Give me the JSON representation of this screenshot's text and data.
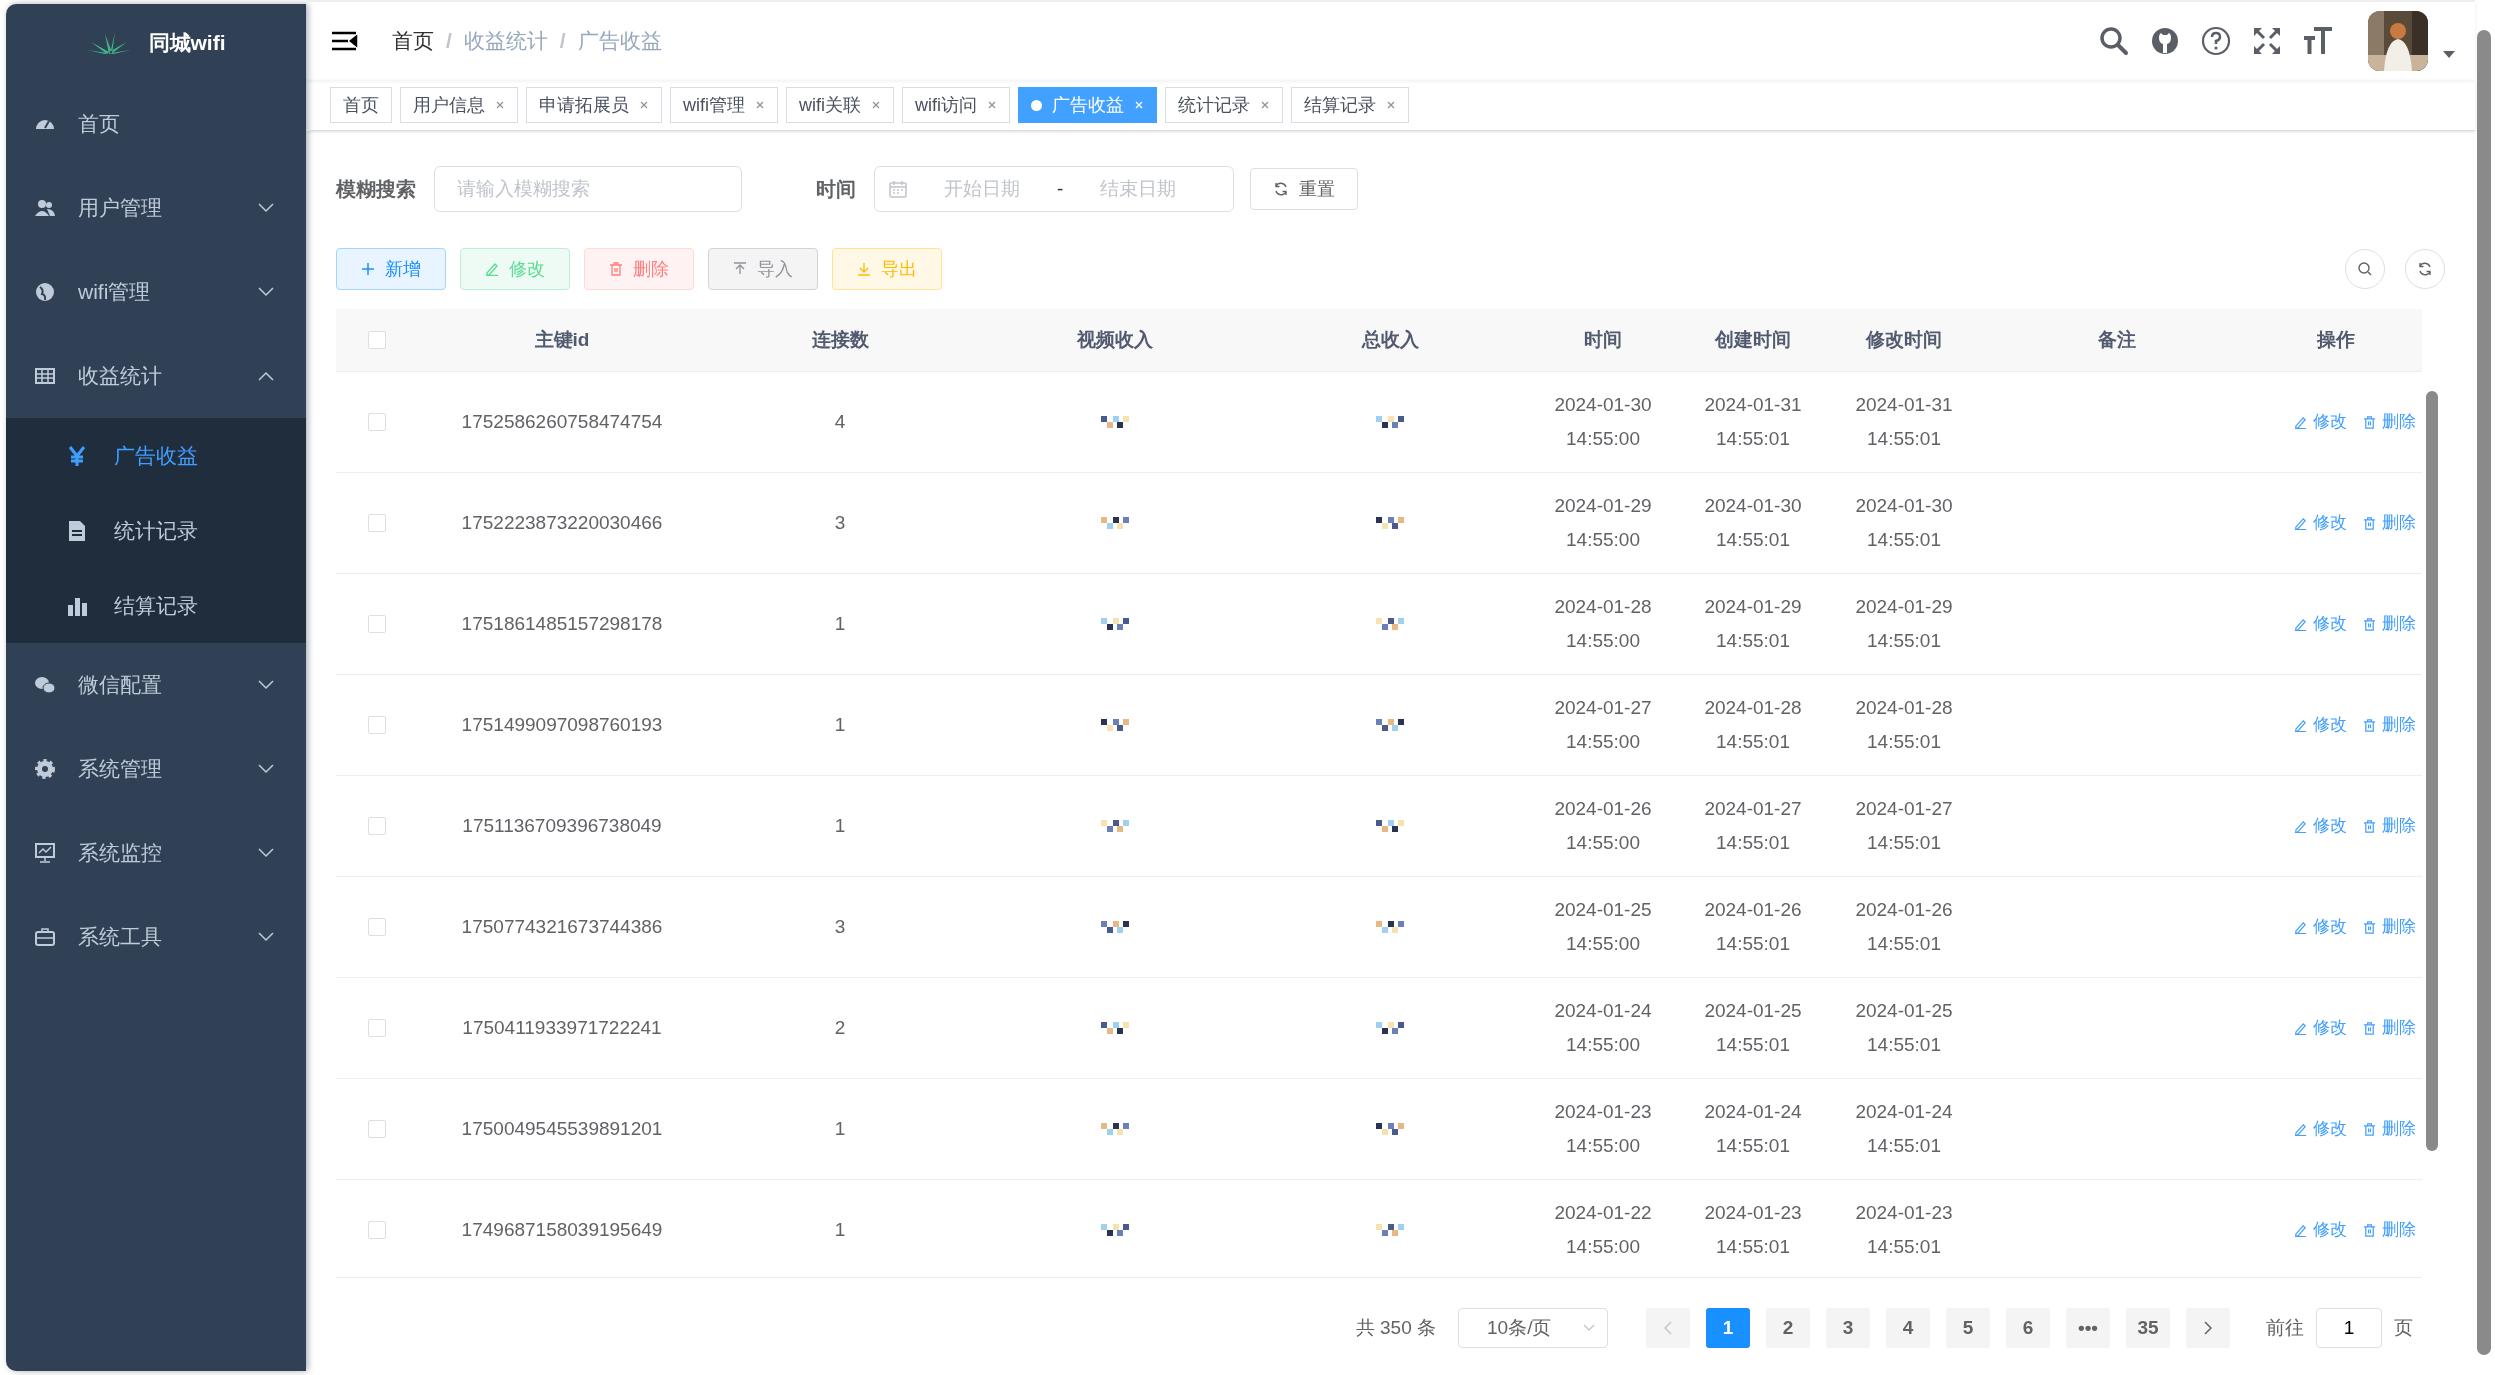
{
  "sidebar": {
    "logo": "同城wifi",
    "items": [
      {
        "label": "首页",
        "kind": "link"
      },
      {
        "label": "用户管理",
        "kind": "group",
        "expanded": false
      },
      {
        "label": "wifi管理",
        "kind": "group",
        "expanded": false
      },
      {
        "label": "收益统计",
        "kind": "group",
        "expanded": true,
        "children": [
          {
            "label": "广告收益",
            "selected": true
          },
          {
            "label": "统计记录",
            "selected": false
          },
          {
            "label": "结算记录",
            "selected": false
          }
        ]
      },
      {
        "label": "微信配置",
        "kind": "group",
        "expanded": false
      },
      {
        "label": "系统管理",
        "kind": "group",
        "expanded": false
      },
      {
        "label": "系统监控",
        "kind": "group",
        "expanded": false
      },
      {
        "label": "系统工具",
        "kind": "group",
        "expanded": false
      }
    ]
  },
  "breadcrumb": {
    "separator": "/",
    "items": [
      "首页",
      "收益统计",
      "广告收益"
    ]
  },
  "tabs": [
    {
      "label": "首页",
      "selected": false,
      "closable": false
    },
    {
      "label": "用户信息",
      "selected": false,
      "closable": true
    },
    {
      "label": "申请拓展员",
      "selected": false,
      "closable": true
    },
    {
      "label": "wifi管理",
      "selected": false,
      "closable": true
    },
    {
      "label": "wifi关联",
      "selected": false,
      "closable": true
    },
    {
      "label": "wifi访问",
      "selected": false,
      "closable": true
    },
    {
      "label": "广告收益",
      "selected": true,
      "closable": true
    },
    {
      "label": "统计记录",
      "selected": false,
      "closable": true
    },
    {
      "label": "结算记录",
      "selected": false,
      "closable": true
    }
  ],
  "search": {
    "label": "模糊搜索",
    "placeholder": "请输入模糊搜索",
    "time_label": "时间",
    "start_placeholder": "开始日期",
    "separator": "-",
    "end_placeholder": "结束日期",
    "reset": "重置"
  },
  "actions": [
    {
      "label": "新增",
      "kind": "add"
    },
    {
      "label": "修改",
      "kind": "edit"
    },
    {
      "label": "删除",
      "kind": "delete"
    },
    {
      "label": "导入",
      "kind": "import"
    },
    {
      "label": "导出",
      "kind": "export"
    }
  ],
  "table": {
    "all_checked": false,
    "columns": [
      "主键id",
      "连接数",
      "视频收入",
      "总收入",
      "时间",
      "创建时间",
      "修改时间",
      "备注",
      "操作"
    ],
    "rows": [
      {
        "id": "1752586260758474754",
        "connections": "4",
        "time": "2024-01-30 14:55:00",
        "created": "2024-01-31 14:55:01",
        "modified": "2024-01-31 14:55:01",
        "checked": false,
        "actions": [
          "修改",
          "删除"
        ]
      },
      {
        "id": "1752223873220030466",
        "connections": "3",
        "time": "2024-01-29 14:55:00",
        "created": "2024-01-30 14:55:01",
        "modified": "2024-01-30 14:55:01",
        "checked": false,
        "actions": [
          "修改",
          "删除"
        ]
      },
      {
        "id": "1751861485157298178",
        "connections": "1",
        "time": "2024-01-28 14:55:00",
        "created": "2024-01-29 14:55:01",
        "modified": "2024-01-29 14:55:01",
        "checked": false,
        "actions": [
          "修改",
          "删除"
        ]
      },
      {
        "id": "1751499097098760193",
        "connections": "1",
        "time": "2024-01-27 14:55:00",
        "created": "2024-01-28 14:55:01",
        "modified": "2024-01-28 14:55:01",
        "checked": false,
        "actions": [
          "修改",
          "删除"
        ]
      },
      {
        "id": "1751136709396738049",
        "connections": "1",
        "time": "2024-01-26 14:55:00",
        "created": "2024-01-27 14:55:01",
        "modified": "2024-01-27 14:55:01",
        "checked": false,
        "actions": [
          "修改",
          "删除"
        ]
      },
      {
        "id": "1750774321673744386",
        "connections": "3",
        "time": "2024-01-25 14:55:00",
        "created": "2024-01-26 14:55:01",
        "modified": "2024-01-26 14:55:01",
        "checked": false,
        "actions": [
          "修改",
          "删除"
        ]
      },
      {
        "id": "1750411933971722241",
        "connections": "2",
        "time": "2024-01-24 14:55:00",
        "created": "2024-01-25 14:55:01",
        "modified": "2024-01-25 14:55:01",
        "checked": false,
        "actions": [
          "修改",
          "删除"
        ]
      },
      {
        "id": "1750049545539891201",
        "connections": "1",
        "time": "2024-01-23 14:55:00",
        "created": "2024-01-24 14:55:01",
        "modified": "2024-01-24 14:55:01",
        "checked": false,
        "actions": [
          "修改",
          "删除"
        ]
      },
      {
        "id": "1749687158039195649",
        "connections": "1",
        "time": "2024-01-22 14:55:00",
        "created": "2024-01-23 14:55:01",
        "modified": "2024-01-23 14:55:01",
        "checked": false,
        "actions": [
          "修改",
          "删除"
        ]
      }
    ]
  },
  "pagination": {
    "total": "共 350 条",
    "page_size": "10条/页",
    "pages": [
      {
        "label": "1",
        "selected": true
      },
      {
        "label": "2",
        "selected": false
      },
      {
        "label": "3",
        "selected": false
      },
      {
        "label": "4",
        "selected": false
      },
      {
        "label": "5",
        "selected": false
      },
      {
        "label": "6",
        "selected": false
      },
      {
        "label": "•••",
        "selected": false
      },
      {
        "label": "35",
        "selected": false
      }
    ],
    "goto_label": "前往",
    "goto_value": "1",
    "goto_suffix": "页"
  }
}
